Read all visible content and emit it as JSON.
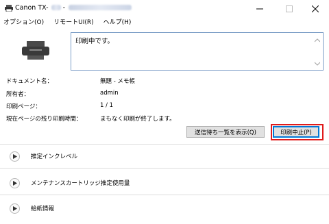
{
  "window": {
    "title": "Canon TX-",
    "title_sep": "-"
  },
  "menu": [
    {
      "label": "オプション(O)"
    },
    {
      "label": "リモートUI(R)"
    },
    {
      "label": "ヘルプ(H)"
    }
  ],
  "status": {
    "message": "印刷中です。"
  },
  "info": [
    {
      "label": "ドキュメント名：",
      "value": "無題 - メモ帳"
    },
    {
      "label": "所有者：",
      "value": "admin"
    },
    {
      "label": "印刷ページ：",
      "value": "1 / 1"
    },
    {
      "label": "現在ページの残り印刷時間：",
      "value": "まもなく印刷が終了します。"
    }
  ],
  "buttons": {
    "queue_label": "送信待ち一覧を表示(Q)",
    "cancel_label": "印刷中止(P)"
  },
  "sections": [
    {
      "label": "推定インクレベル"
    },
    {
      "label": "メンテナンスカートリッジ推定使用量"
    },
    {
      "label": "給紙情報"
    }
  ],
  "colors": {
    "highlight": "#e01b1b",
    "focus": "#0078d7"
  }
}
